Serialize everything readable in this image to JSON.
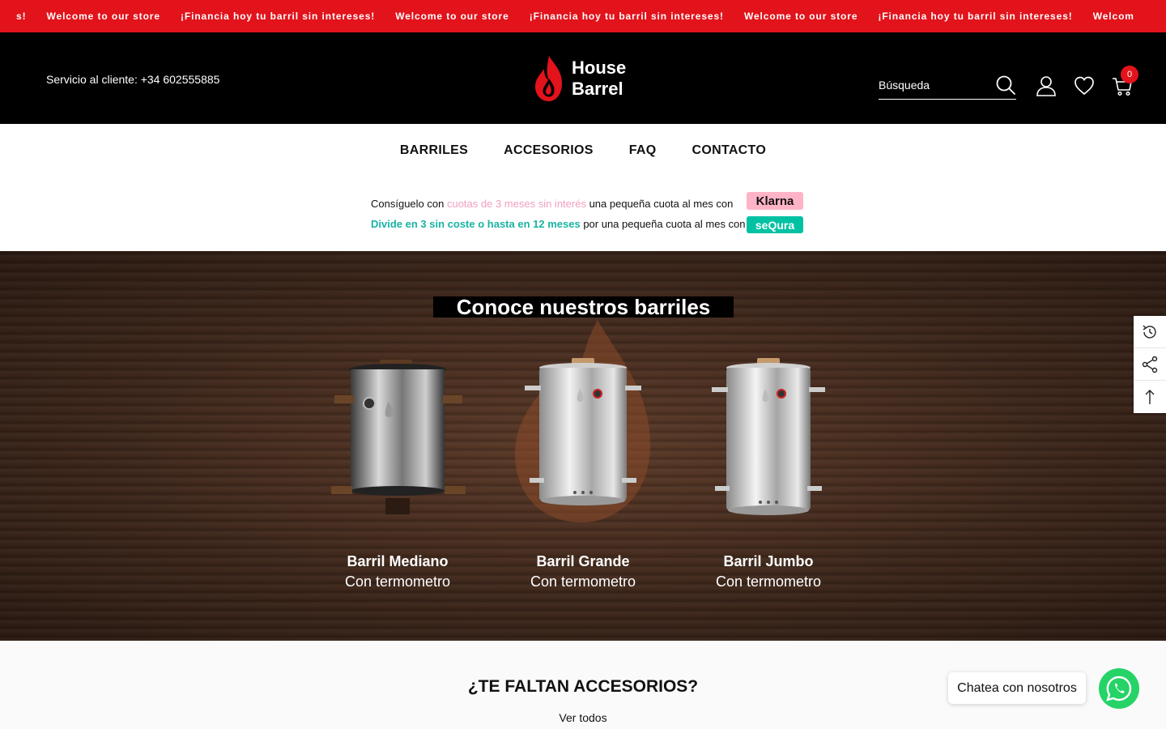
{
  "announcement": {
    "items": [
      "s!",
      "Welcome to our store",
      "¡Financia hoy tu barril sin intereses!",
      "Welcome to our store",
      "¡Financia hoy tu barril sin intereses!",
      "Welcome to our store",
      "¡Financia hoy tu barril sin intereses!",
      "Welcom"
    ],
    "color": "#e2131b"
  },
  "header": {
    "service_text": "Servicio al cliente: +34 602555885",
    "logo_line1": "House",
    "logo_line2": "Barrel",
    "search_placeholder": "Búsqueda",
    "cart_count": "0",
    "icons": [
      "search-icon",
      "account-icon",
      "wishlist-icon",
      "cart-icon"
    ]
  },
  "nav": {
    "items": [
      "BARRILES",
      "ACCESORIOS",
      "FAQ",
      "CONTACTO"
    ]
  },
  "financing": {
    "line1_prefix": "Consíguelo con",
    "line1_highlight": "cuotas de 3 meses sin interés",
    "line1_suffix": "una pequeña cuota al mes con",
    "klarna_label": "Klarna",
    "line2_highlight": "Divide en 3 sin coste o hasta en 12 meses",
    "line2_suffix": "por una pequeña cuota al mes con",
    "sequra_label": "seQura"
  },
  "hero": {
    "title": "Conoce nuestros barriles",
    "barrels": [
      {
        "name": "Barril Mediano",
        "subtitle": "Con termometro"
      },
      {
        "name": "Barril Grande",
        "subtitle": "Con termometro"
      },
      {
        "name": "Barril Jumbo",
        "subtitle": "Con termometro"
      }
    ]
  },
  "sidetools": [
    "recently-viewed-icon",
    "share-icon",
    "back-to-top-icon"
  ],
  "accessories": {
    "title": "¿TE FALTAN ACCESORIOS?",
    "link": "Ver todos"
  },
  "chat": {
    "label": "Chatea con nosotros"
  }
}
